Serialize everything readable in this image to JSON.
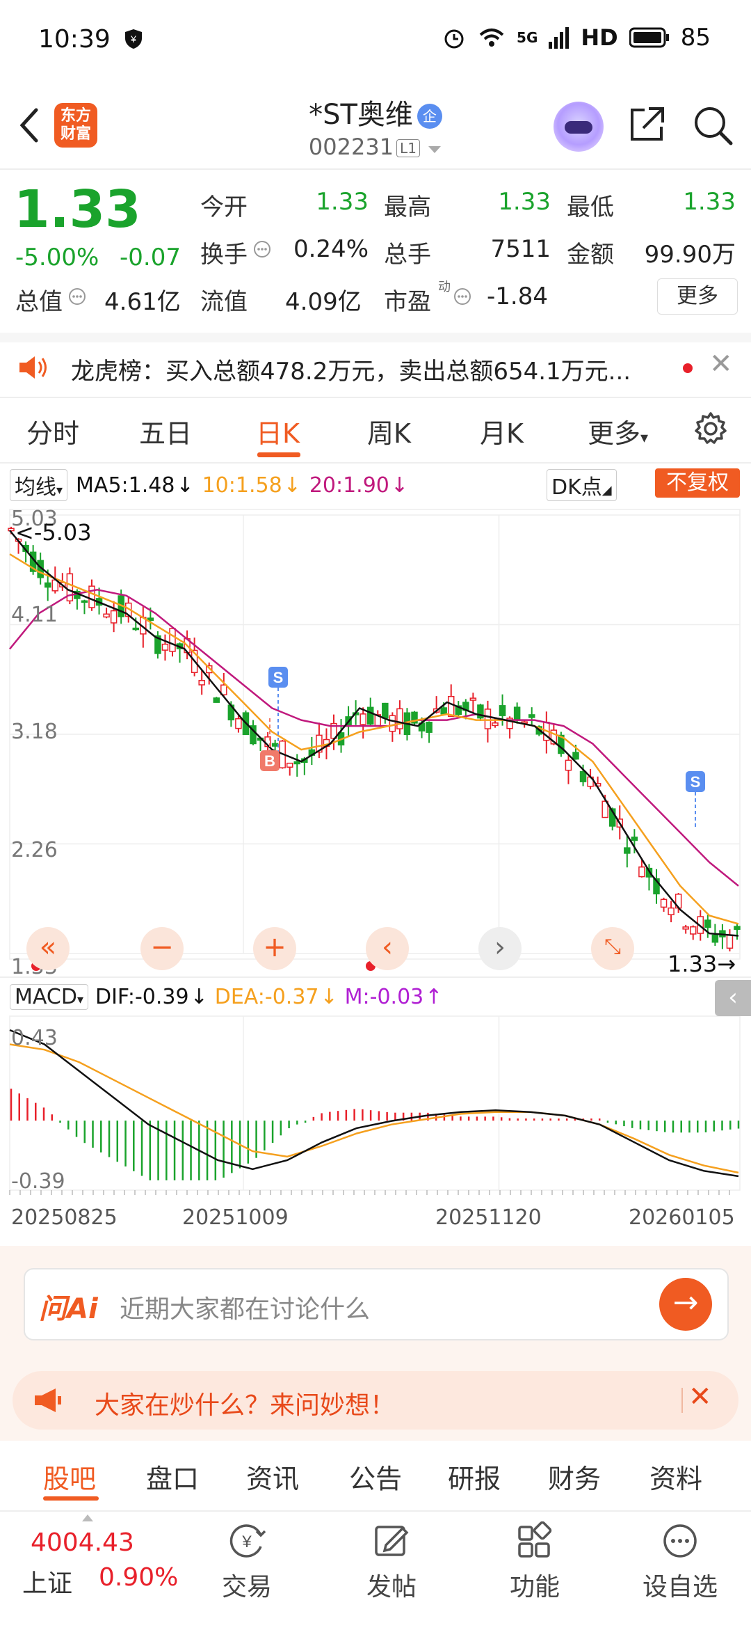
{
  "status_bar": {
    "time": "10:39",
    "net": "5G",
    "hd": "HD",
    "battery": "85"
  },
  "header": {
    "logo_line1": "东方",
    "logo_line2": "财富",
    "name": "*ST奥维",
    "badge": "企",
    "code": "002231",
    "level": "L1"
  },
  "quote": {
    "price": "1.33",
    "change_pct": "-5.00%",
    "change": "-0.07",
    "open_label": "今开",
    "open": "1.33",
    "high_label": "最高",
    "high": "1.33",
    "low_label": "最低",
    "low": "1.33",
    "turnover_label": "换手",
    "turnover": "0.24%",
    "volume_label": "总手",
    "volume": "7511",
    "amount_label": "金额",
    "amount": "99.90万",
    "mktcap_label": "总值",
    "mktcap": "4.61亿",
    "float_label": "流值",
    "float": "4.09亿",
    "pe_label": "市盈",
    "pe_sup": "动",
    "pe": "-1.84",
    "more": "更多"
  },
  "notice": {
    "text": "龙虎榜：买入总额478.2万元，卖出总额654.1万元..."
  },
  "tabs": [
    "分时",
    "五日",
    "日K",
    "周K",
    "月K",
    "更多"
  ],
  "active_tab": "日K",
  "indicators": {
    "ma_select": "均线",
    "ma5": "MA5:1.48",
    "ma10": "10:1.58",
    "ma20": "20:1.90",
    "dk": "DK点",
    "fq": "不复权",
    "macd_select": "MACD",
    "dif": "DIF:-0.39",
    "dea": "DEA:-0.37",
    "m": "M:-0.03"
  },
  "colors": {
    "up": "#e8202a",
    "down": "#1aa32c",
    "ma5": "#111111",
    "ma10": "#f5a01e",
    "ma20": "#c0197d",
    "accent": "#f05b22"
  },
  "chart_data": [
    {
      "type": "candlestick",
      "y_ticks": [
        "5.03",
        "4.11",
        "3.18",
        "2.26",
        "1.33"
      ],
      "ylim": [
        1.33,
        5.03
      ],
      "annotations": {
        "max": "5.03",
        "last": "1.33",
        "signals": [
          "S",
          "B",
          "S"
        ]
      },
      "ma5": [
        4.9,
        4.6,
        4.4,
        4.3,
        4.2,
        4.0,
        3.9,
        3.6,
        3.3,
        3.05,
        2.95,
        3.1,
        3.4,
        3.3,
        3.25,
        3.45,
        3.35,
        3.3,
        3.25,
        3.05,
        2.8,
        2.4,
        2.0,
        1.7,
        1.5,
        1.48
      ],
      "ma10": [
        4.7,
        4.55,
        4.45,
        4.35,
        4.25,
        4.1,
        3.95,
        3.7,
        3.45,
        3.2,
        3.05,
        3.1,
        3.2,
        3.25,
        3.3,
        3.35,
        3.3,
        3.3,
        3.25,
        3.15,
        2.95,
        2.6,
        2.25,
        1.9,
        1.65,
        1.58
      ],
      "ma20": [
        3.9,
        4.2,
        4.35,
        4.4,
        4.35,
        4.2,
        4.0,
        3.8,
        3.6,
        3.4,
        3.3,
        3.25,
        3.25,
        3.25,
        3.3,
        3.3,
        3.35,
        3.3,
        3.3,
        3.25,
        3.1,
        2.85,
        2.6,
        2.35,
        2.1,
        1.9
      ]
    },
    {
      "type": "macd",
      "y_ticks": [
        "0.43",
        "-0.39"
      ],
      "ylim": [
        -0.39,
        0.43
      ],
      "x_ticks": [
        "20250825",
        "20251009",
        "20251120",
        "20260105"
      ],
      "dif": [
        0.43,
        0.35,
        0.2,
        0.05,
        -0.1,
        -0.2,
        -0.3,
        -0.35,
        -0.3,
        -0.2,
        -0.12,
        -0.08,
        -0.05,
        -0.03,
        -0.02,
        -0.03,
        -0.05,
        -0.1,
        -0.2,
        -0.3,
        -0.36,
        -0.39
      ],
      "dea": [
        0.35,
        0.32,
        0.25,
        0.15,
        0.05,
        -0.05,
        -0.15,
        -0.25,
        -0.28,
        -0.22,
        -0.15,
        -0.1,
        -0.07,
        -0.04,
        -0.03,
        -0.03,
        -0.05,
        -0.1,
        -0.18,
        -0.27,
        -0.33,
        -0.37
      ]
    }
  ],
  "ai": {
    "logo": "问Ai",
    "placeholder": "近期大家都在讨论什么"
  },
  "hot": {
    "text": "大家在炒什么？来问妙想！"
  },
  "bottom_tabs": [
    "股吧",
    "盘口",
    "资讯",
    "公告",
    "研报",
    "财务",
    "资料"
  ],
  "footer": {
    "index_value": "4004.43",
    "index_name": "上证",
    "index_change": "0.90%",
    "trade": "交易",
    "post": "发帖",
    "func": "功能",
    "watch": "设自选"
  }
}
